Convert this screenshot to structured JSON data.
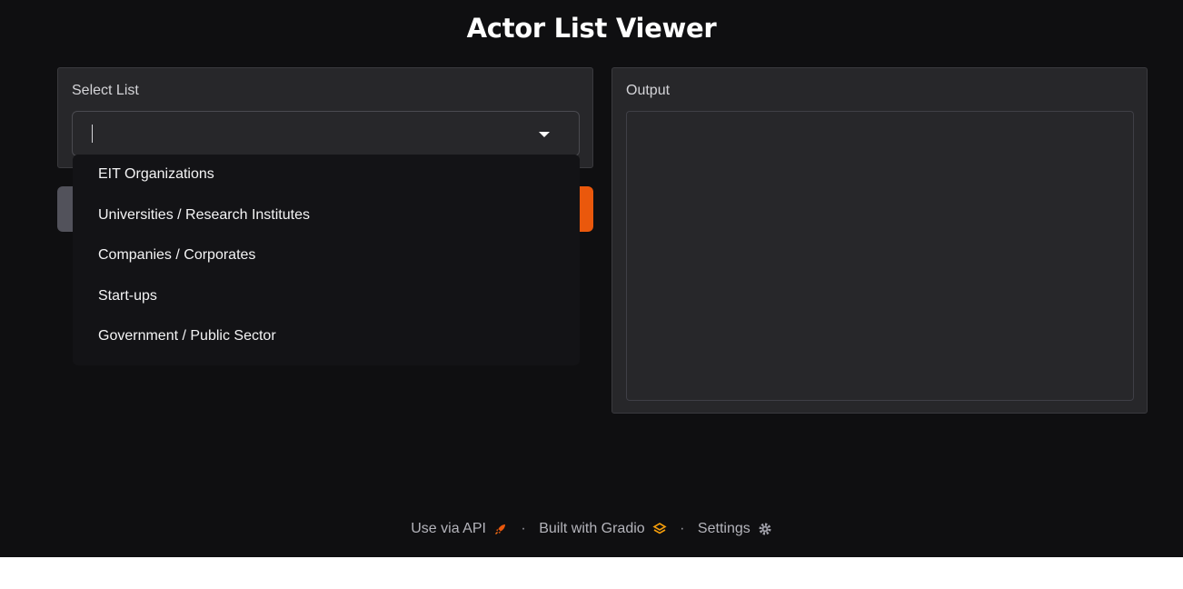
{
  "app": {
    "title": "Actor List Viewer"
  },
  "select_panel": {
    "label": "Select List",
    "value": ""
  },
  "dropdown": {
    "options": [
      "EIT Organizations",
      "Universities / Research Institutes",
      "Companies / Corporates",
      "Start-ups",
      "Government / Public Sector"
    ]
  },
  "output_panel": {
    "label": "Output",
    "value": ""
  },
  "footer": {
    "api_link": "Use via API",
    "built_with": "Built with Gradio",
    "settings": "Settings",
    "separator": "·"
  },
  "colors": {
    "background": "#0f0f11",
    "panel": "#27272a",
    "submit_button": "#ea580c",
    "clear_button": "#52525b"
  },
  "icons": {
    "api": "rocket-icon",
    "gradio": "gradio-logo-icon",
    "settings": "gear-icon",
    "dropdown": "chevron-down-icon"
  }
}
